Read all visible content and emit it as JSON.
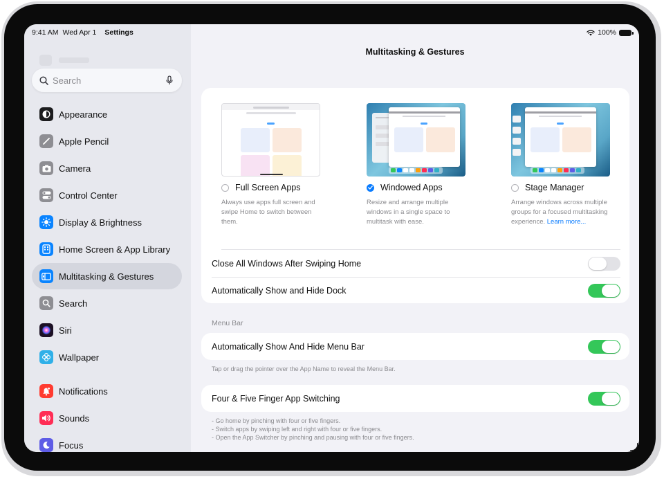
{
  "status": {
    "time": "9:41 AM",
    "date": "Wed Apr 1",
    "app": "Settings",
    "battery": "100%"
  },
  "search": {
    "placeholder": "Search"
  },
  "sidebar": {
    "items": [
      {
        "label": "Appearance",
        "icon": "appearance-icon",
        "color": "#1c1c1e"
      },
      {
        "label": "Apple Pencil",
        "icon": "pencil-icon",
        "color": "#8e8e93"
      },
      {
        "label": "Camera",
        "icon": "camera-icon",
        "color": "#8e8e93"
      },
      {
        "label": "Control Center",
        "icon": "control-center-icon",
        "color": "#8e8e93"
      },
      {
        "label": "Display & Brightness",
        "icon": "brightness-icon",
        "color": "#0a84ff"
      },
      {
        "label": "Home Screen & App Library",
        "icon": "home-screen-icon",
        "color": "#0a84ff"
      },
      {
        "label": "Multitasking & Gestures",
        "icon": "multitasking-icon",
        "color": "#0a84ff"
      },
      {
        "label": "Search",
        "icon": "search-icon",
        "color": "#8e8e93"
      },
      {
        "label": "Siri",
        "icon": "siri-icon",
        "color": "#3a2a66"
      },
      {
        "label": "Wallpaper",
        "icon": "wallpaper-icon",
        "color": "#30b0e8"
      },
      {
        "label": "Notifications",
        "icon": "notifications-icon",
        "color": "#ff3b30"
      },
      {
        "label": "Sounds",
        "icon": "sounds-icon",
        "color": "#ff2d55"
      },
      {
        "label": "Focus",
        "icon": "focus-icon",
        "color": "#5e5ce6"
      }
    ]
  },
  "page": {
    "title": "Multitasking & Gestures"
  },
  "modes": [
    {
      "label": "Full Screen Apps",
      "desc": "Always use apps full screen and swipe Home to switch between them.",
      "selected": false
    },
    {
      "label": "Windowed Apps",
      "desc": "Resize and arrange multiple windows in a single space to multitask with ease.",
      "selected": true
    },
    {
      "label": "Stage Manager",
      "desc": "Arrange windows across multiple groups for a focused multitasking experience.",
      "link": "Learn more...",
      "selected": false
    }
  ],
  "settings": {
    "close_all": {
      "label": "Close All Windows After Swiping Home",
      "on": false
    },
    "show_dock": {
      "label": "Automatically Show and Hide Dock",
      "on": true
    },
    "menu_bar_header": "Menu Bar",
    "menu_bar": {
      "label": "Automatically Show And Hide Menu Bar",
      "on": true
    },
    "menu_bar_foot": "Tap or drag the pointer over the App Name to reveal the Menu Bar.",
    "finger_switch": {
      "label": "Four & Five Finger App Switching",
      "on": true
    },
    "finger_foot": [
      "- Go home by pinching with four or five fingers.",
      "- Switch apps by swiping left and right with four or five fingers.",
      "- Open the App Switcher by pinching and pausing with four or five fingers."
    ]
  },
  "colors": {
    "accent": "#0a7cff",
    "toggle_on": "#34c759"
  }
}
